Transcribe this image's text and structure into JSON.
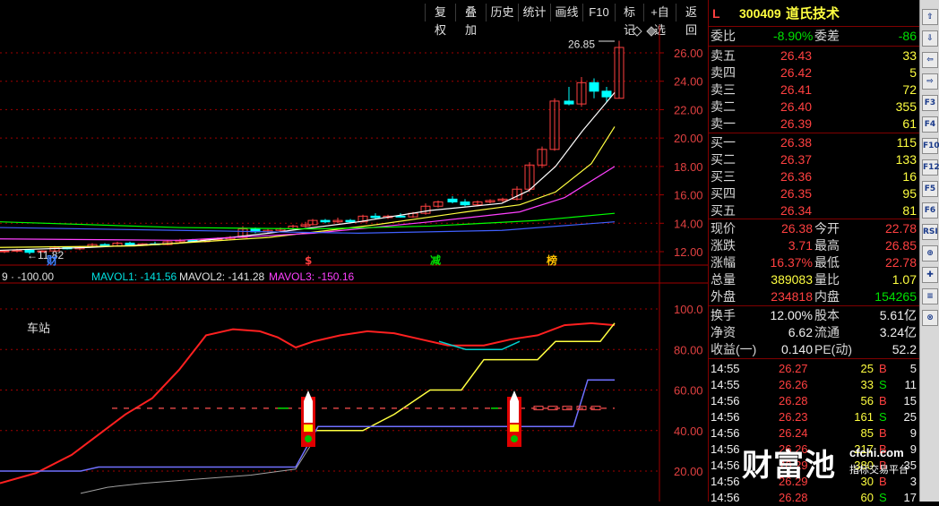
{
  "toolbar": {
    "buttons": [
      "复权",
      "叠加",
      "历史",
      "统计",
      "画线",
      "F10",
      "标记",
      "+自选",
      "返回"
    ]
  },
  "main_chart": {
    "y_ticks": [
      "26.00",
      "24.00",
      "22.00",
      "20.00",
      "18.00",
      "16.00",
      "14.00",
      "12.00"
    ],
    "high_label": "26.85",
    "low_label": "←11.82",
    "markers": [
      {
        "text": "财",
        "color": "#4080ff"
      },
      {
        "text": "$",
        "color": "#ff4040"
      },
      {
        "text": "减",
        "color": "#00e000"
      },
      {
        "text": "榜",
        "color": "#ffc000"
      }
    ]
  },
  "volume_header": {
    "prefix": "9 · -100.00",
    "mavol1": "MAVOL1: -141.56",
    "mavol2": "MAVOL2: -141.28",
    "mavol3": "MAVOL3: -150.16"
  },
  "indicator": {
    "title": "车站",
    "y_ticks": [
      "100.0",
      "80.00",
      "60.00",
      "40.00",
      "20.00"
    ]
  },
  "quote": {
    "code": "300409",
    "name": "道氏技术",
    "flag": "L",
    "ratio_label": "委比",
    "ratio_value": "-8.90%",
    "diff_label": "委差",
    "diff_value": "-86",
    "asks": [
      {
        "label": "卖五",
        "price": "26.43",
        "vol": "33"
      },
      {
        "label": "卖四",
        "price": "26.42",
        "vol": "5"
      },
      {
        "label": "卖三",
        "price": "26.41",
        "vol": "72"
      },
      {
        "label": "卖二",
        "price": "26.40",
        "vol": "355"
      },
      {
        "label": "卖一",
        "price": "26.39",
        "vol": "61"
      }
    ],
    "bids": [
      {
        "label": "买一",
        "price": "26.38",
        "vol": "115"
      },
      {
        "label": "买二",
        "price": "26.37",
        "vol": "133"
      },
      {
        "label": "买三",
        "price": "26.36",
        "vol": "16"
      },
      {
        "label": "买四",
        "price": "26.35",
        "vol": "95"
      },
      {
        "label": "买五",
        "price": "26.34",
        "vol": "81"
      }
    ],
    "stats": [
      {
        "l1": "现价",
        "v1": "26.38",
        "c1": "red",
        "l2": "今开",
        "v2": "22.78",
        "c2": "red"
      },
      {
        "l1": "涨跌",
        "v1": "3.71",
        "c1": "red",
        "l2": "最高",
        "v2": "26.85",
        "c2": "red"
      },
      {
        "l1": "涨幅",
        "v1": "16.37%",
        "c1": "red",
        "l2": "最低",
        "v2": "22.78",
        "c2": "red"
      },
      {
        "l1": "总量",
        "v1": "389083",
        "c1": "yellow",
        "l2": "量比",
        "v2": "1.07",
        "c2": "yellow"
      },
      {
        "l1": "外盘",
        "v1": "234818",
        "c1": "red",
        "l2": "内盘",
        "v2": "154265",
        "c2": "green"
      }
    ],
    "stats2": [
      {
        "l1": "换手",
        "v1": "12.00%",
        "l2": "股本",
        "v2": "5.61亿"
      },
      {
        "l1": "净资",
        "v1": "6.62",
        "l2": "流通",
        "v2": "3.24亿"
      },
      {
        "l1": "收益(一)",
        "v1": "0.140",
        "l2": "PE(动)",
        "v2": "52.2"
      }
    ],
    "ticks": [
      {
        "t": "14:55",
        "p": "26.27",
        "v": "25",
        "bs": "B",
        "n": "5"
      },
      {
        "t": "14:55",
        "p": "26.26",
        "v": "33",
        "bs": "S",
        "n": "11"
      },
      {
        "t": "14:56",
        "p": "26.28",
        "v": "56",
        "bs": "B",
        "n": "15"
      },
      {
        "t": "14:56",
        "p": "26.23",
        "v": "161",
        "bs": "S",
        "n": "25"
      },
      {
        "t": "14:56",
        "p": "26.24",
        "v": "85",
        "bs": "B",
        "n": "9"
      },
      {
        "t": "14:56",
        "p": "26.26",
        "v": "217",
        "bs": "B",
        "n": "9"
      },
      {
        "t": "14:56",
        "p": "26.29",
        "v": "380",
        "bs": "B",
        "n": "35"
      },
      {
        "t": "14:56",
        "p": "26.29",
        "v": "30",
        "bs": "B",
        "n": "3"
      },
      {
        "t": "14:56",
        "p": "26.28",
        "v": "60",
        "bs": "S",
        "n": "17"
      }
    ]
  },
  "sidebar": {
    "buttons": [
      "⇧",
      "⇩",
      "⇦",
      "⇨",
      "F3",
      "F4",
      "F10",
      "F12",
      "F5",
      "F6",
      "RSI",
      "⊕",
      "✚",
      "≡",
      "⊗"
    ]
  },
  "watermark": {
    "main": "财富池",
    "url": "cfchi.com",
    "sub": "指标交易平台"
  },
  "colors": {
    "up": "#ff4040",
    "down": "#00ffff",
    "ma5": "#ffffff",
    "ma10": "#ffff40",
    "ma20": "#ff40ff",
    "ma60": "#00ff00"
  }
}
